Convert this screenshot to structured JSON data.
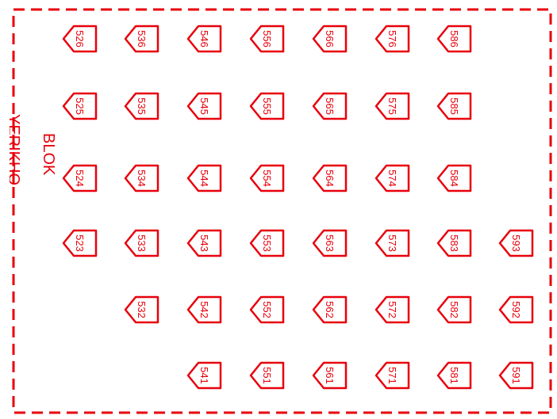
{
  "colors": {
    "plan_red": "#e8000b",
    "background": "#ffffff"
  },
  "block": {
    "line1": "BLOK",
    "line2": "YERIKHO"
  },
  "plots": [
    {
      "id": "526",
      "row": 0,
      "col": 0
    },
    {
      "id": "536",
      "row": 0,
      "col": 1
    },
    {
      "id": "546",
      "row": 0,
      "col": 2
    },
    {
      "id": "556",
      "row": 0,
      "col": 3
    },
    {
      "id": "566",
      "row": 0,
      "col": 4
    },
    {
      "id": "576",
      "row": 0,
      "col": 5
    },
    {
      "id": "586",
      "row": 0,
      "col": 6
    },
    {
      "id": "525",
      "row": 1,
      "col": 0
    },
    {
      "id": "535",
      "row": 1,
      "col": 1
    },
    {
      "id": "545",
      "row": 1,
      "col": 2
    },
    {
      "id": "555",
      "row": 1,
      "col": 3
    },
    {
      "id": "565",
      "row": 1,
      "col": 4
    },
    {
      "id": "575",
      "row": 1,
      "col": 5
    },
    {
      "id": "585",
      "row": 1,
      "col": 6
    },
    {
      "id": "524",
      "row": 2,
      "col": 0
    },
    {
      "id": "534",
      "row": 2,
      "col": 1
    },
    {
      "id": "544",
      "row": 2,
      "col": 2
    },
    {
      "id": "554",
      "row": 2,
      "col": 3
    },
    {
      "id": "564",
      "row": 2,
      "col": 4
    },
    {
      "id": "574",
      "row": 2,
      "col": 5
    },
    {
      "id": "584",
      "row": 2,
      "col": 6
    },
    {
      "id": "523",
      "row": 3,
      "col": 0
    },
    {
      "id": "533",
      "row": 3,
      "col": 1
    },
    {
      "id": "543",
      "row": 3,
      "col": 2
    },
    {
      "id": "553",
      "row": 3,
      "col": 3
    },
    {
      "id": "563",
      "row": 3,
      "col": 4
    },
    {
      "id": "573",
      "row": 3,
      "col": 5
    },
    {
      "id": "583",
      "row": 3,
      "col": 6
    },
    {
      "id": "593",
      "row": 3,
      "col": 7
    },
    {
      "id": "532",
      "row": 4,
      "col": 1
    },
    {
      "id": "542",
      "row": 4,
      "col": 2
    },
    {
      "id": "552",
      "row": 4,
      "col": 3
    },
    {
      "id": "562",
      "row": 4,
      "col": 4
    },
    {
      "id": "572",
      "row": 4,
      "col": 5
    },
    {
      "id": "582",
      "row": 4,
      "col": 6
    },
    {
      "id": "592",
      "row": 4,
      "col": 7
    },
    {
      "id": "541",
      "row": 5,
      "col": 2
    },
    {
      "id": "551",
      "row": 5,
      "col": 3
    },
    {
      "id": "561",
      "row": 5,
      "col": 4
    },
    {
      "id": "571",
      "row": 5,
      "col": 5
    },
    {
      "id": "581",
      "row": 5,
      "col": 6
    },
    {
      "id": "591",
      "row": 5,
      "col": 7
    }
  ]
}
